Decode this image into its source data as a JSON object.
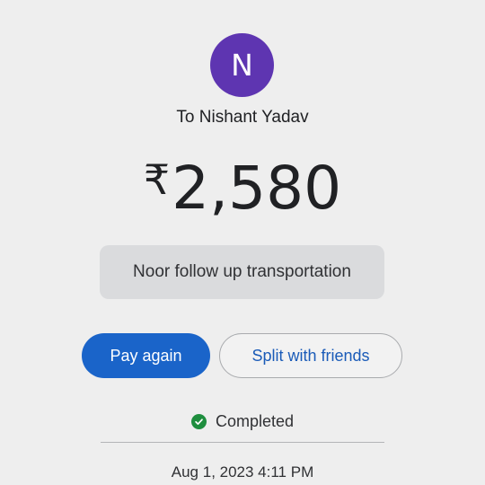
{
  "avatar": {
    "initial": "N",
    "color": "#5e35b1"
  },
  "recipient": {
    "label": "To Nishant Yadav"
  },
  "amount": {
    "currency_symbol": "₹",
    "value": "2,580"
  },
  "note": {
    "text": "Noor follow up transportation"
  },
  "actions": {
    "pay_again_label": "Pay again",
    "split_label": "Split with friends",
    "primary_color": "#1a64c9"
  },
  "status": {
    "text": "Completed",
    "icon": "check-circle-icon",
    "color": "#1e8e3e"
  },
  "timestamp": {
    "text": "Aug 1, 2023 4:11 PM"
  }
}
